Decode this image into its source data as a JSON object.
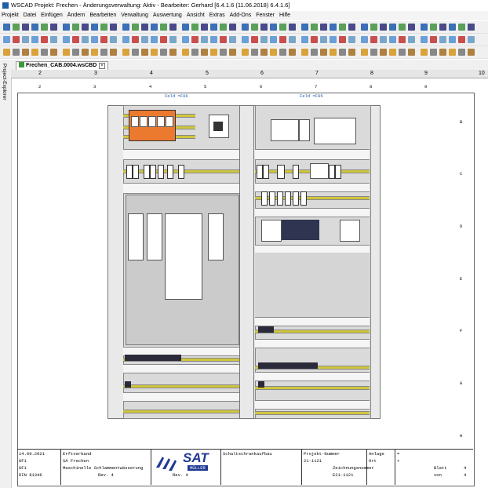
{
  "titlebar": {
    "title": "WSCAD  Projekt: Frechen  - Änderungsverwaltung: Aktiv - Bearbeiter: Gerhard [6.4.1.6 (11.06.2018) 6.4.1.6]"
  },
  "menu": [
    "Projekt",
    "Datei",
    "Einfügen",
    "Ändern",
    "Bearbeiten",
    "Verwaltung",
    "Auswertung",
    "Ansicht",
    "Extras",
    "Add-Ons",
    "Fenster",
    "Hilfe"
  ],
  "side_panel": {
    "label": "Project-Explorer"
  },
  "document_tab": {
    "label": "Frechen_CAB.0004.wsCBD",
    "close": "×"
  },
  "ruler": [
    "2",
    "3",
    "4",
    "5",
    "6",
    "7",
    "8",
    "9",
    "10"
  ],
  "sheet_columns": [
    "2",
    "3",
    "4",
    "5",
    "6",
    "7",
    "8",
    "9"
  ],
  "sheet_rows": [
    "B",
    "C",
    "D",
    "E",
    "F",
    "G",
    "H"
  ],
  "fields": {
    "left": "Feld =F06",
    "right": "Feld =F05"
  },
  "title_block": {
    "date": "14.09.2021",
    "checker1": "GF1",
    "checker2": "GF1",
    "norm": "DIN 81346",
    "client": "Erftverband",
    "plant": "SA Frechen",
    "description": "Maschinelle Schlammentwässerung",
    "revision_label": "Rev. 4",
    "revision_value": "Rev. 4",
    "company": "SAT",
    "company_sub": "MÜLLER",
    "drawing_title": "Schaltschrankaufbau",
    "project_label": "Projekt-Nummer",
    "project_number": "21-1121",
    "drawing_label": "Zeichnungsnummer",
    "drawing_number": "E21-1121",
    "plant_label": "Anlage",
    "plant_value": "=",
    "location_label": "Ort",
    "location_value": "+",
    "sheet_label": "Blatt",
    "sheet_value": "4",
    "of_label": "von",
    "of_value": "4"
  },
  "colors": {
    "rail": "#cfc63c",
    "orange": "#ec7a2e",
    "accent_blue": "#1f5fa8",
    "green_tab": "#3a9a3a"
  }
}
